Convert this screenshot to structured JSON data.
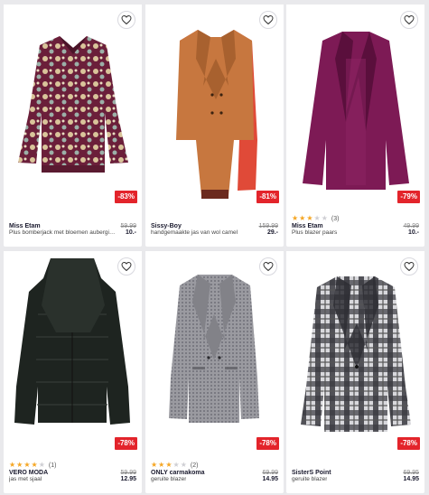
{
  "products": [
    {
      "brand": "Miss Etam",
      "desc": "Plus bomberjack met bloemen aubergine",
      "old_price": "59.99",
      "new_price": "10.-",
      "discount": "-83%",
      "rating": 0,
      "reviews": ""
    },
    {
      "brand": "Sissy-Boy",
      "desc": "handgemaakte jas van wol camel",
      "old_price": "159.99",
      "new_price": "29.-",
      "discount": "-81%",
      "rating": 0,
      "reviews": ""
    },
    {
      "brand": "Miss Etam",
      "desc": "Plus blazer paars",
      "old_price": "49.99",
      "new_price": "10.-",
      "discount": "-79%",
      "rating": 3,
      "reviews": "(3)"
    },
    {
      "brand": "VERO MODA",
      "desc": "jas met sjaal",
      "old_price": "59.99",
      "new_price": "12.95",
      "discount": "-78%",
      "rating": 4,
      "reviews": "(1)"
    },
    {
      "brand": "ONLY carmakoma",
      "desc": "geruite blazer",
      "old_price": "69.99",
      "new_price": "14.95",
      "discount": "-78%",
      "rating": 3,
      "reviews": "(2)"
    },
    {
      "brand": "SisterS Point",
      "desc": "geruite blazer",
      "old_price": "69.95",
      "new_price": "14.95",
      "discount": "-78%",
      "rating": 0,
      "reviews": ""
    }
  ],
  "colors": {
    "discount_badge": "#e3242b",
    "star": "#f5a623"
  },
  "icons": {
    "favorite": "heart-icon",
    "rating": "star-icon"
  }
}
